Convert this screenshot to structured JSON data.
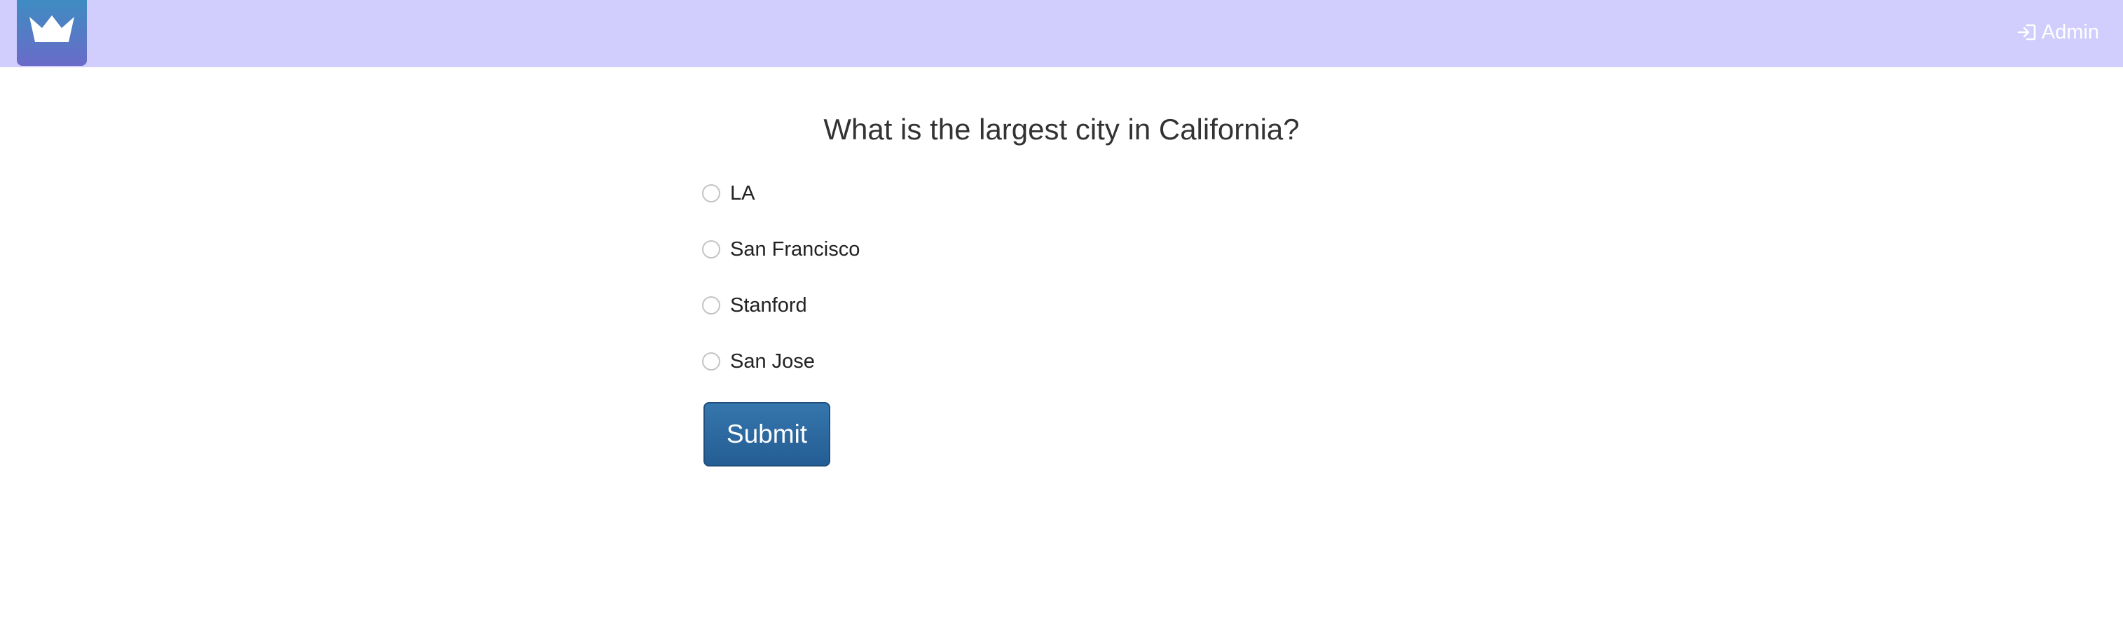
{
  "header": {
    "logo_icon": "crown-icon",
    "admin_icon": "sign-in-icon",
    "admin_label": "Admin",
    "background": "#d1cdfd"
  },
  "quiz": {
    "question": "What is the largest city in California?",
    "options": [
      {
        "label": "LA",
        "selected": false
      },
      {
        "label": "San Francisco",
        "selected": false
      },
      {
        "label": "Stanford",
        "selected": false
      },
      {
        "label": "San Jose",
        "selected": false
      }
    ],
    "submit_label": "Submit"
  },
  "colors": {
    "accent": "#2b679e",
    "logo_gradient_top": "#3e8cc1",
    "logo_gradient_bottom": "#6a6bc9"
  }
}
